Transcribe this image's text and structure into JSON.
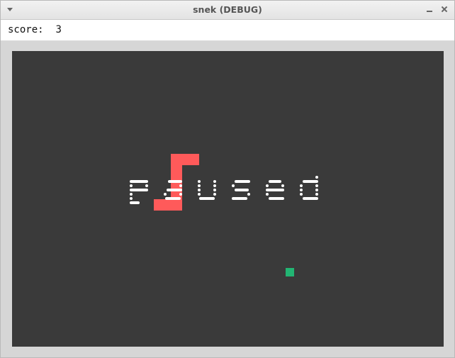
{
  "window": {
    "title": "snek (DEBUG)"
  },
  "score": {
    "label": "score:",
    "value": "3"
  },
  "game": {
    "status_text": "paused",
    "colors": {
      "background": "#3a3a3a",
      "snake": "#ff5a5a",
      "food": "#22b573",
      "text": "#ffffff"
    },
    "icons": {
      "window_menu": "chevron-down-icon",
      "minimize": "minimize-icon",
      "close": "close-icon"
    }
  }
}
